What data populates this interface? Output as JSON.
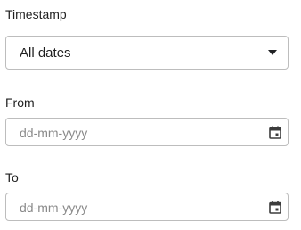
{
  "timestamp": {
    "label": "Timestamp",
    "selected": "All dates",
    "caret_icon": "triangle-down-icon"
  },
  "from": {
    "label": "From",
    "placeholder": "dd-mm-yyyy",
    "icon": "calendar-icon"
  },
  "to": {
    "label": "To",
    "placeholder": "dd-mm-yyyy",
    "icon": "calendar-icon"
  }
}
